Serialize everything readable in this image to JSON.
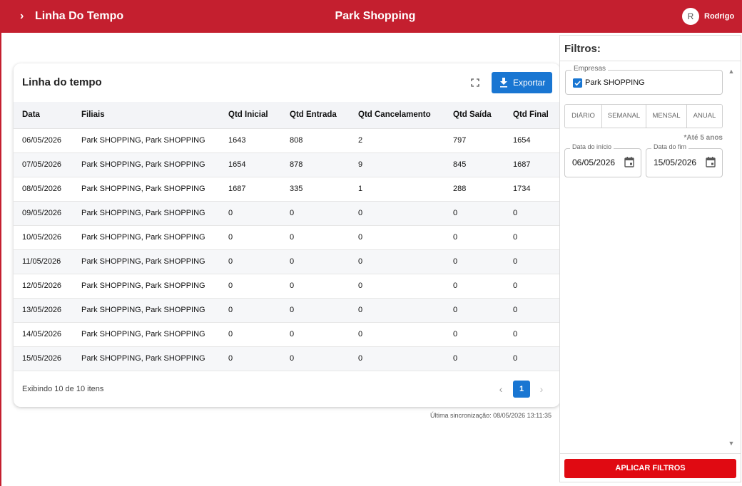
{
  "header": {
    "nav_chevron": "›",
    "app_title": "Linha Do Tempo",
    "store_name": "Park Shopping",
    "avatar_initial": "R",
    "username": "Rodrigo"
  },
  "card": {
    "title": "Linha do tempo",
    "export_label": "Exportar",
    "columns": [
      "Data",
      "Filiais",
      "Qtd Inicial",
      "Qtd Entrada",
      "Qtd Cancelamento",
      "Qtd Saída",
      "Qtd Final"
    ],
    "rows": [
      [
        "06/05/2026",
        "Park SHOPPING, Park SHOPPING",
        "1643",
        "808",
        "2",
        "797",
        "1654"
      ],
      [
        "07/05/2026",
        "Park SHOPPING, Park SHOPPING",
        "1654",
        "878",
        "9",
        "845",
        "1687"
      ],
      [
        "08/05/2026",
        "Park SHOPPING, Park SHOPPING",
        "1687",
        "335",
        "1",
        "288",
        "1734"
      ],
      [
        "09/05/2026",
        "Park SHOPPING, Park SHOPPING",
        "0",
        "0",
        "0",
        "0",
        "0"
      ],
      [
        "10/05/2026",
        "Park SHOPPING, Park SHOPPING",
        "0",
        "0",
        "0",
        "0",
        "0"
      ],
      [
        "11/05/2026",
        "Park SHOPPING, Park SHOPPING",
        "0",
        "0",
        "0",
        "0",
        "0"
      ],
      [
        "12/05/2026",
        "Park SHOPPING, Park SHOPPING",
        "0",
        "0",
        "0",
        "0",
        "0"
      ],
      [
        "13/05/2026",
        "Park SHOPPING, Park SHOPPING",
        "0",
        "0",
        "0",
        "0",
        "0"
      ],
      [
        "14/05/2026",
        "Park SHOPPING, Park SHOPPING",
        "0",
        "0",
        "0",
        "0",
        "0"
      ],
      [
        "15/05/2026",
        "Park SHOPPING, Park SHOPPING",
        "0",
        "0",
        "0",
        "0",
        "0"
      ]
    ],
    "footer_count": "Exibindo 10 de 10 itens",
    "current_page": "1",
    "prev_glyph": "‹",
    "next_glyph": "›"
  },
  "sync_text": "Última sincronização: 08/05/2026 13:11:35",
  "filters": {
    "title": "Filtros:",
    "companies_legend": "Empresas",
    "company_option": "Park SHOPPING",
    "company_checked": true,
    "periods": [
      "DIÁRIO",
      "SEMANAL",
      "MENSAL",
      "ANUAL"
    ],
    "range_note": "*Até 5 anos",
    "start_legend": "Data do início",
    "start_value": "06/05/2026",
    "end_legend": "Data do fim",
    "end_value": "15/05/2026",
    "apply_label": "APLICAR FILTROS",
    "scroll_up_glyph": "▲",
    "scroll_down_glyph": "▼"
  },
  "colors": {
    "brand_red": "#c41f2f",
    "apply_red": "#e00a12",
    "primary_blue": "#1976d2"
  },
  "icons": {
    "nav": "chevron-right-icon",
    "fullscreen": "fullscreen-icon",
    "export": "download-icon",
    "calendar": "calendar-icon",
    "checkbox": "checkbox-checked-icon"
  }
}
